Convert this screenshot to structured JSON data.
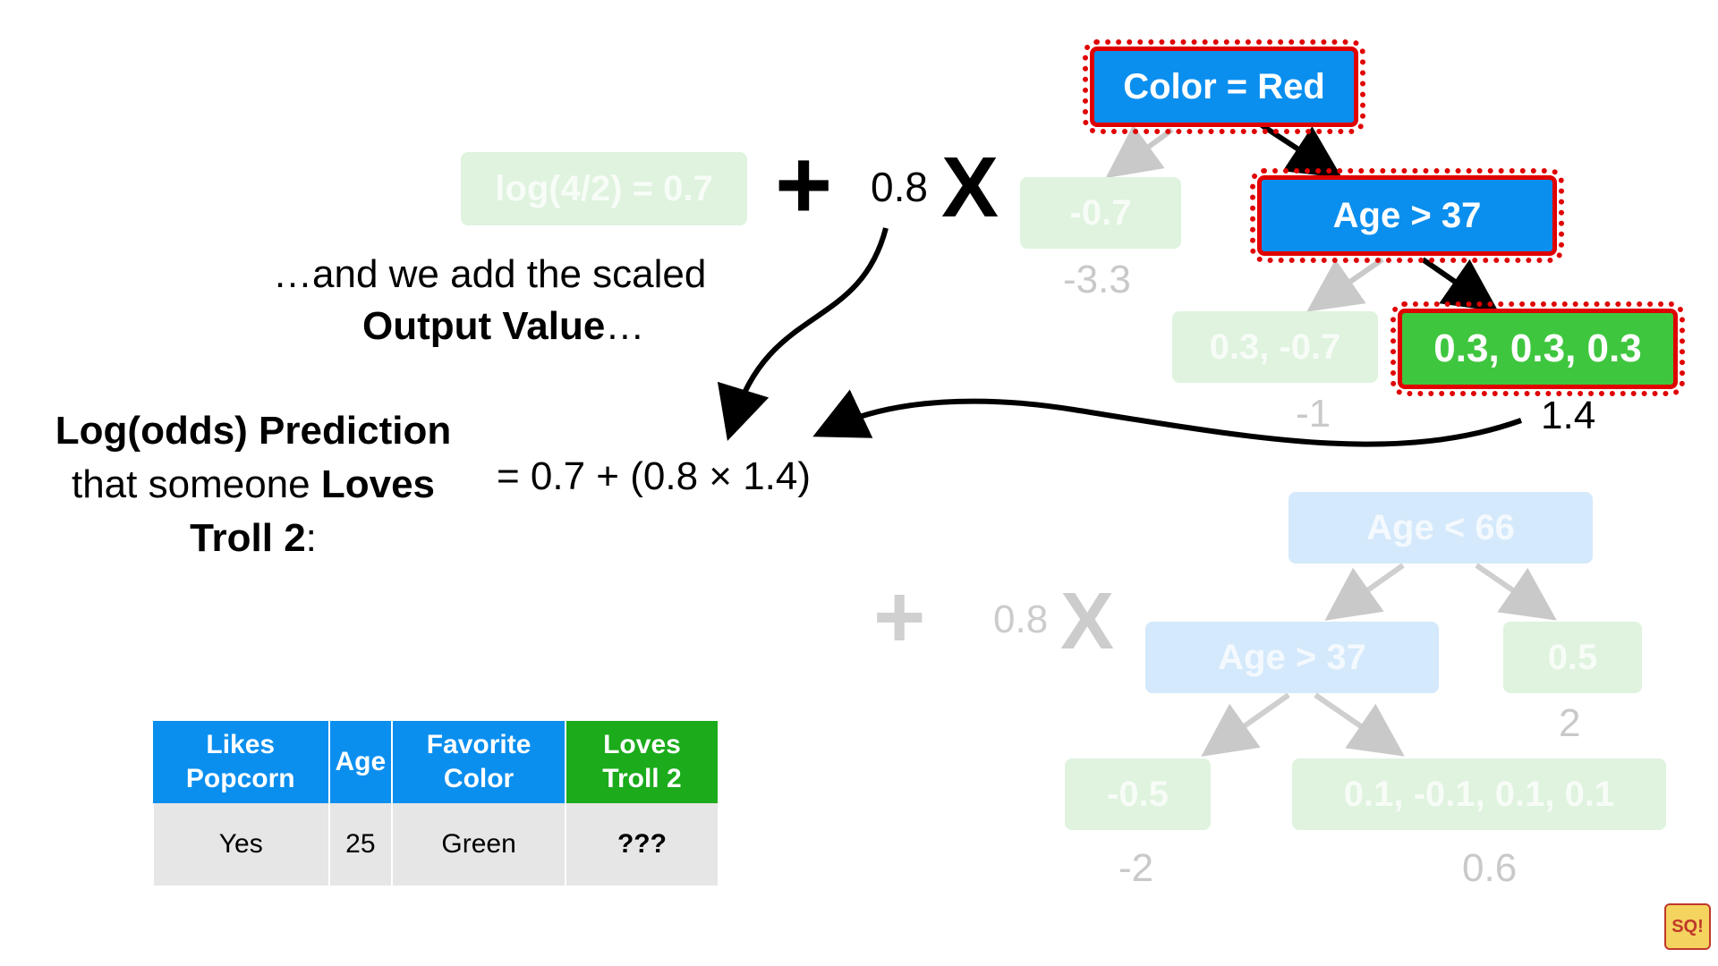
{
  "initial_prediction": "log(4/2) = 0.7",
  "learning_rate": "0.8",
  "narration": {
    "line1": "…and we add the scaled",
    "line2_bold": "Output Value",
    "line2_tail": "…"
  },
  "prediction_label": {
    "l1_bold": "Log(odds) Prediction",
    "l2": "that someone ",
    "l2_bold": "Loves",
    "l3_bold": "Troll 2",
    "l3_tail": ":"
  },
  "equation": "= 0.7 + (0.8 × 1.4)",
  "tree1": {
    "root": "Color = Red",
    "left_leaf": "-0.7",
    "left_leaf_value": "-3.3",
    "inner": "Age > 37",
    "inner_left_leaf": "0.3, -0.7",
    "inner_left_value": "-1",
    "inner_right_leaf": "0.3, 0.3, 0.3",
    "inner_right_value": "1.4"
  },
  "tree2": {
    "learning_rate": "0.8",
    "root": "Age < 66",
    "right_leaf": "0.5",
    "right_leaf_value": "2",
    "inner": "Age > 37",
    "inner_left_leaf": "-0.5",
    "inner_left_value": "-2",
    "inner_right_leaf": "0.1, -0.1, 0.1, 0.1",
    "inner_right_value": "0.6"
  },
  "table": {
    "headers": [
      "Likes Popcorn",
      "Age",
      "Favorite Color",
      "Loves Troll 2"
    ],
    "row": [
      "Yes",
      "25",
      "Green",
      "???"
    ]
  },
  "logo_text": "SQ!",
  "colors": {
    "blue": "#0a8fef",
    "green": "#3fc63f",
    "highlight": "#e00000"
  }
}
